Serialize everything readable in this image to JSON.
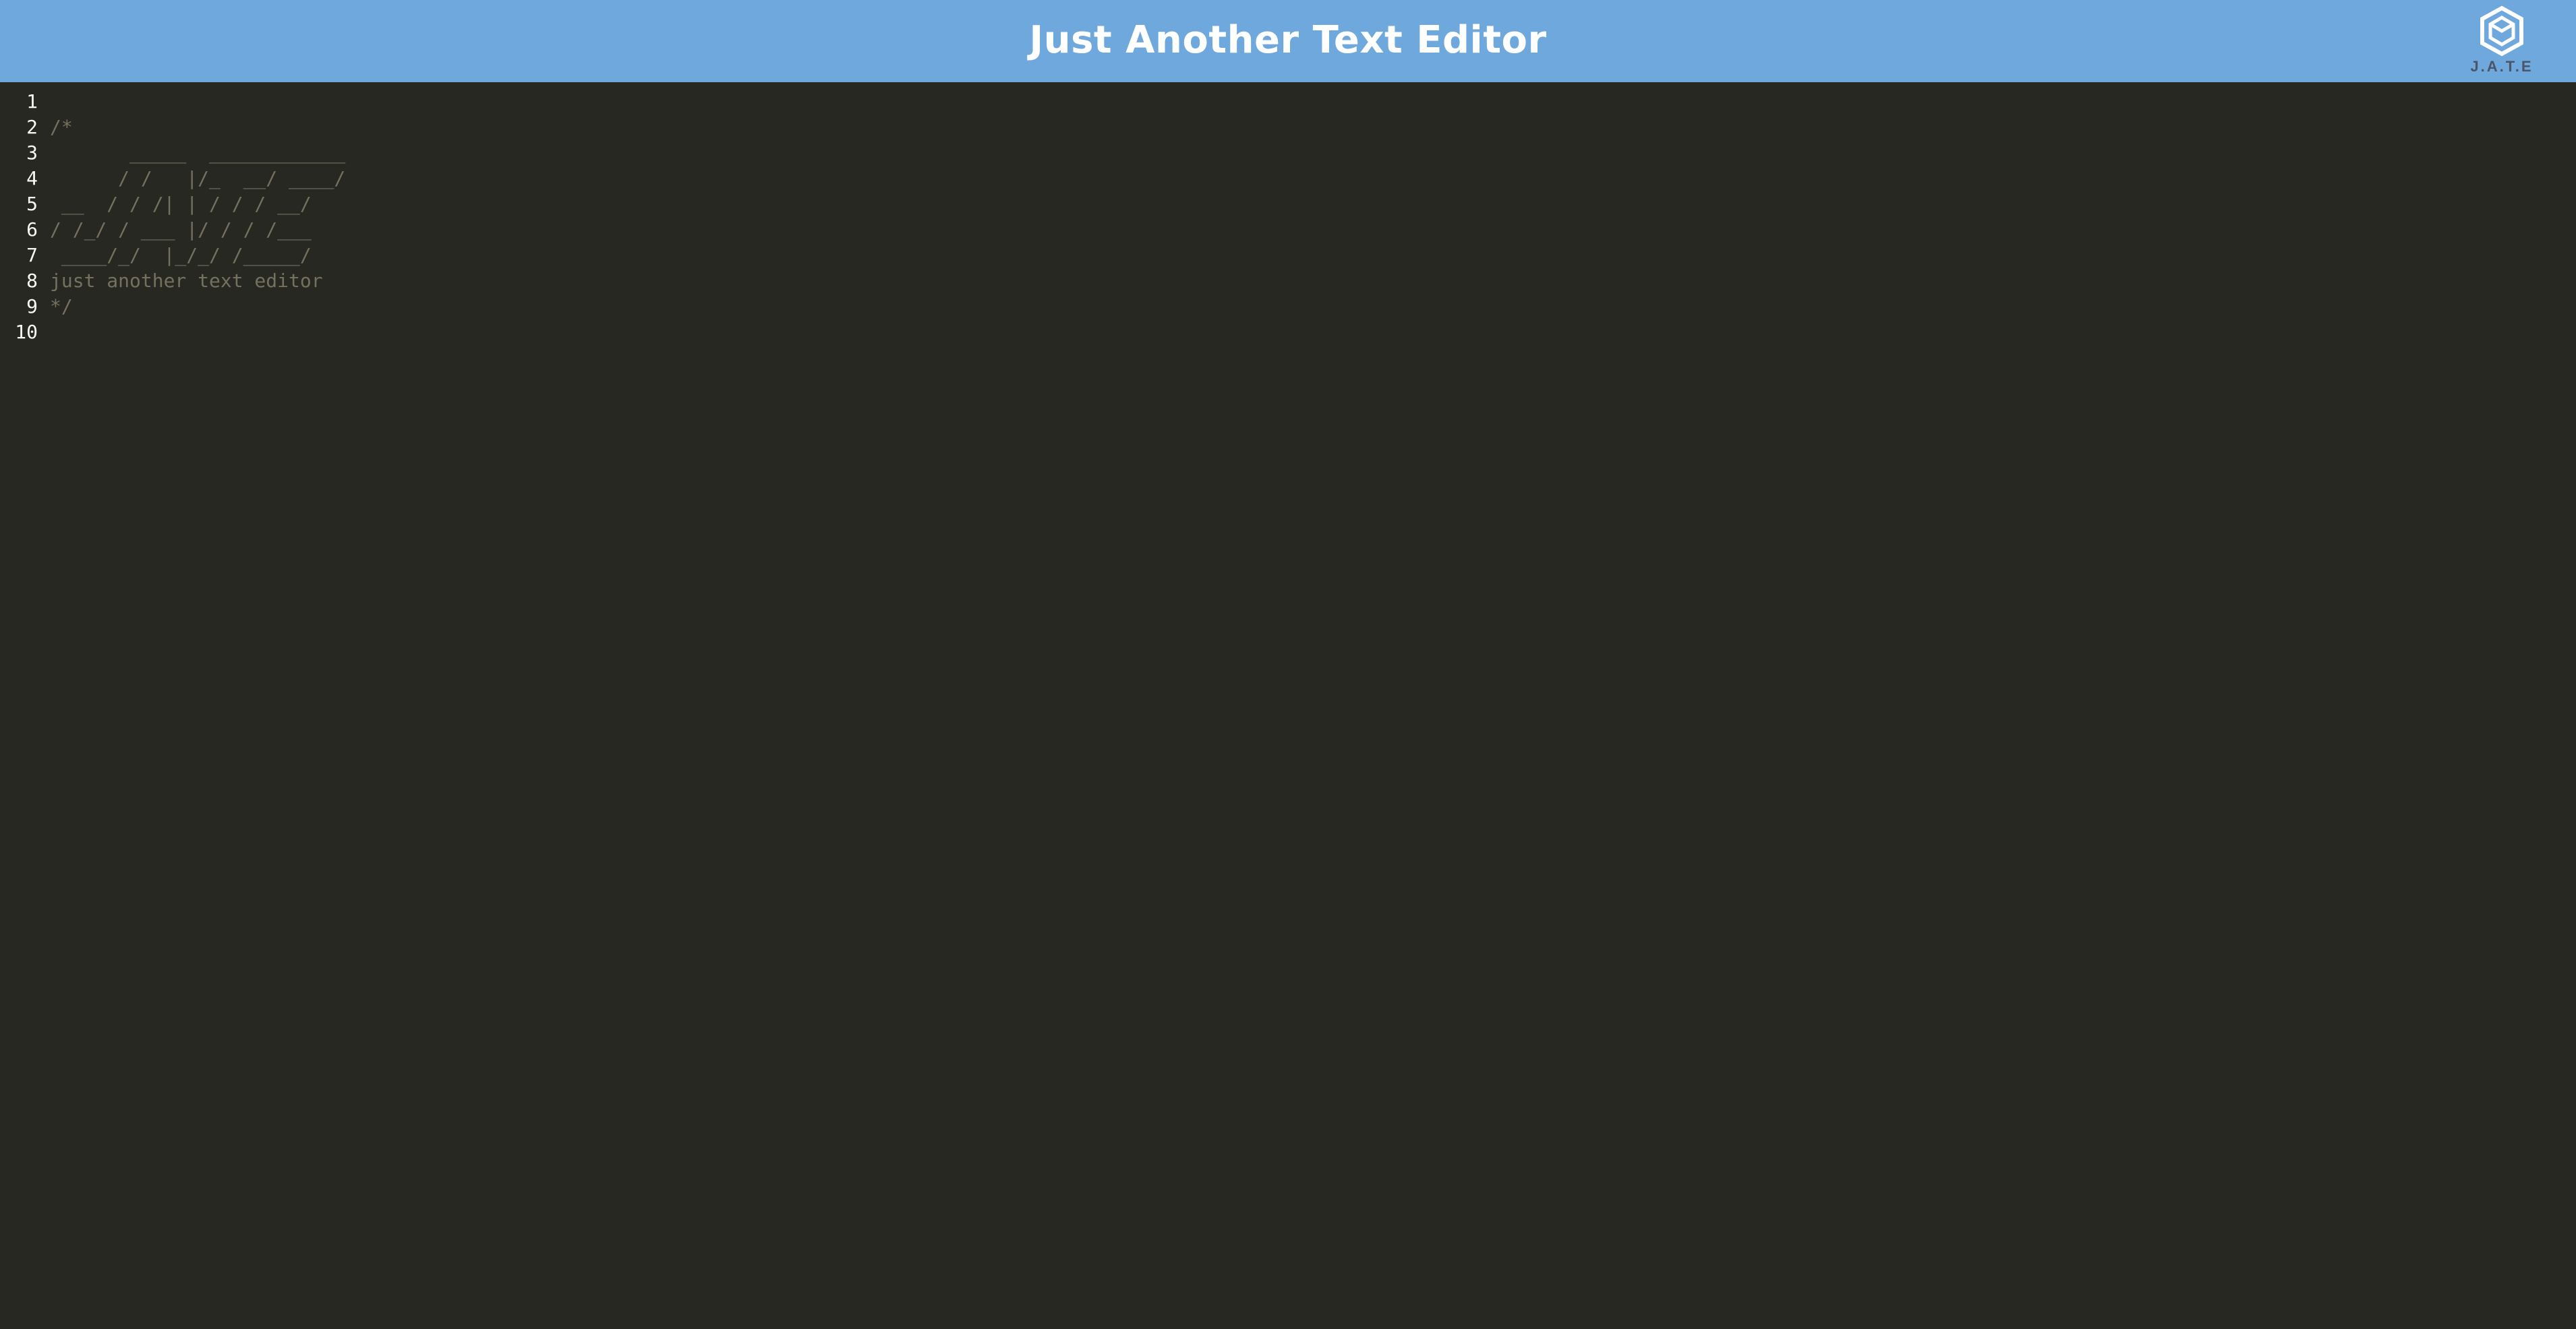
{
  "header": {
    "title": "Just Another Text Editor",
    "logo_text": "J.A.T.E",
    "logo_icon": "jate-cube-logo-icon",
    "background_color": "#6fa8dc"
  },
  "editor": {
    "theme_background": "#272822",
    "comment_color": "#75715e",
    "lines": [
      {
        "number": "1",
        "text": ""
      },
      {
        "number": "2",
        "text": "/*"
      },
      {
        "number": "3",
        "text": "       _____  ____________"
      },
      {
        "number": "4",
        "text": "      / /   |/_  __/ ____/"
      },
      {
        "number": "5",
        "text": " __  / / /| | / / / __/"
      },
      {
        "number": "6",
        "text": "/ /_/ / ___ |/ / / /___"
      },
      {
        "number": "7",
        "text": " ____/_/  |_/_/ /_____/"
      },
      {
        "number": "8",
        "text": "just another text editor"
      },
      {
        "number": "9",
        "text": "*/"
      },
      {
        "number": "10",
        "text": ""
      }
    ]
  }
}
